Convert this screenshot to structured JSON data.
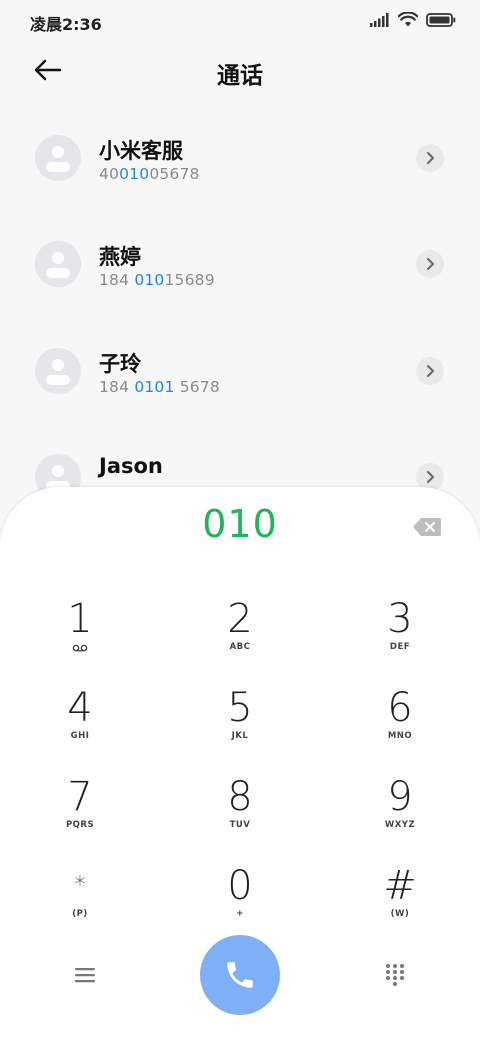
{
  "status_bar": {
    "time": "凌晨2:36"
  },
  "header": {
    "title": "通话"
  },
  "contacts": [
    {
      "name": "小米客服",
      "number_pre": "40",
      "number_hl": "010",
      "number_post": "05678"
    },
    {
      "name": "燕婷",
      "number_pre": "184 ",
      "number_hl": "010",
      "number_post": "15689"
    },
    {
      "name": "子玲",
      "number_pre": "184 ",
      "number_hl": "0101",
      "number_post": " 5678"
    },
    {
      "name": "Jason",
      "number_pre": "",
      "number_hl": "",
      "number_post": ""
    }
  ],
  "dialpad": {
    "entered": "010",
    "keys": [
      {
        "digit": "1",
        "sub": ""
      },
      {
        "digit": "2",
        "sub": "ABC"
      },
      {
        "digit": "3",
        "sub": "DEF"
      },
      {
        "digit": "4",
        "sub": "GHI"
      },
      {
        "digit": "5",
        "sub": "JKL"
      },
      {
        "digit": "6",
        "sub": "MNO"
      },
      {
        "digit": "7",
        "sub": "PQRS"
      },
      {
        "digit": "8",
        "sub": "TUV"
      },
      {
        "digit": "9",
        "sub": "WXYZ"
      },
      {
        "digit": "*",
        "sub": "(P)"
      },
      {
        "digit": "0",
        "sub": "+"
      },
      {
        "digit": "#",
        "sub": "(W)"
      }
    ]
  },
  "colors": {
    "highlight": "#1e88e5",
    "dialed": "#1fb558",
    "call_button": "#7fb0f5"
  },
  "icons": {
    "back": "arrow-left-icon",
    "chevron": "chevron-right-icon",
    "backspace": "backspace-icon",
    "voicemail": "voicemail-icon",
    "menu": "menu-icon",
    "call": "phone-icon",
    "dialpad_toggle": "dialpad-grid-icon"
  }
}
